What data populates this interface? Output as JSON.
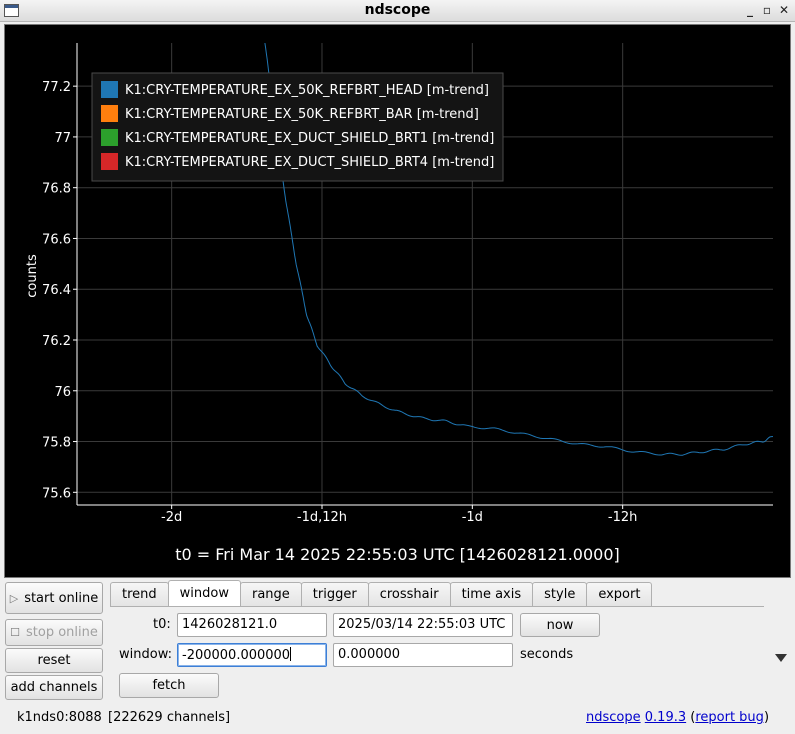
{
  "window": {
    "title": "ndscope"
  },
  "plot": {
    "ylabel": "counts",
    "t0_label": "t0 = Fri Mar 14 2025 22:55:03 UTC [1426028121.0000]",
    "background": "#000000",
    "grid_color": "#3a3a3a"
  },
  "legend": [
    {
      "label": "K1:CRY-TEMPERATURE_EX_50K_REFBRT_HEAD [m-trend]",
      "color": "#1f77b4"
    },
    {
      "label": "K1:CRY-TEMPERATURE_EX_50K_REFBRT_BAR [m-trend]",
      "color": "#ff7f0e"
    },
    {
      "label": "K1:CRY-TEMPERATURE_EX_DUCT_SHIELD_BRT1 [m-trend]",
      "color": "#2ca02c"
    },
    {
      "label": "K1:CRY-TEMPERATURE_EX_DUCT_SHIELD_BRT4 [m-trend]",
      "color": "#d62728"
    }
  ],
  "chart_data": {
    "type": "line",
    "title": "",
    "xlabel": "",
    "ylabel": "counts",
    "x_ticks": [
      {
        "label": "-2d",
        "value": -172800
      },
      {
        "label": "-1d,12h",
        "value": -129600
      },
      {
        "label": "-1d",
        "value": -86400
      },
      {
        "label": "-12h",
        "value": -43200
      }
    ],
    "y_ticks": [
      75.6,
      75.8,
      76,
      76.2,
      76.4,
      76.6,
      76.8,
      77,
      77.2
    ],
    "xlim": [
      -200000,
      0
    ],
    "ylim": [
      75.55,
      77.37
    ],
    "grid": true,
    "legend_position": "top-left",
    "series": [
      {
        "name": "K1:CRY-TEMPERATURE_EX_50K_REFBRT_HEAD [m-trend]",
        "color": "#1f77b4",
        "points": [
          [
            -146000,
            77.37
          ],
          [
            -143000,
            77.05
          ],
          [
            -140000,
            76.75
          ],
          [
            -137000,
            76.5
          ],
          [
            -134000,
            76.3
          ],
          [
            -131000,
            76.18
          ],
          [
            -127000,
            76.1
          ],
          [
            -123000,
            76.03
          ],
          [
            -118000,
            75.98
          ],
          [
            -112000,
            75.94
          ],
          [
            -106000,
            75.91
          ],
          [
            -100000,
            75.89
          ],
          [
            -94000,
            75.88
          ],
          [
            -88000,
            75.86
          ],
          [
            -80000,
            75.85
          ],
          [
            -72000,
            75.83
          ],
          [
            -64000,
            75.81
          ],
          [
            -56000,
            75.79
          ],
          [
            -48000,
            75.78
          ],
          [
            -40000,
            75.76
          ],
          [
            -32000,
            75.75
          ],
          [
            -26000,
            75.75
          ],
          [
            -20000,
            75.76
          ],
          [
            -14000,
            75.77
          ],
          [
            -8000,
            75.79
          ],
          [
            -3000,
            75.8
          ],
          [
            0,
            75.82
          ]
        ]
      }
    ]
  },
  "left_buttons": {
    "start_online": "start online",
    "stop_online": "stop online",
    "reset": "reset",
    "add_channels": "add channels"
  },
  "tabs": [
    {
      "label": "trend",
      "active": false
    },
    {
      "label": "window",
      "active": true
    },
    {
      "label": "range",
      "active": false
    },
    {
      "label": "trigger",
      "active": false
    },
    {
      "label": "crosshair",
      "active": false
    },
    {
      "label": "time axis",
      "active": false
    },
    {
      "label": "style",
      "active": false
    },
    {
      "label": "export",
      "active": false
    }
  ],
  "window_tab": {
    "t0_label": "t0:",
    "t0_gps": "1426028121.0",
    "t0_utc": "2025/03/14 22:55:03 UTC",
    "now_button": "now",
    "window_label": "window:",
    "window_start": "-200000.000000",
    "window_end": "0.000000",
    "units": "seconds",
    "fetch_button": "fetch"
  },
  "status": {
    "server": "k1nds0:8088",
    "channels": "[222629 channels]",
    "app_name": "ndscope",
    "version": "0.19.3",
    "open_paren": "(",
    "report_bug": "report bug",
    "close_paren": ")"
  }
}
